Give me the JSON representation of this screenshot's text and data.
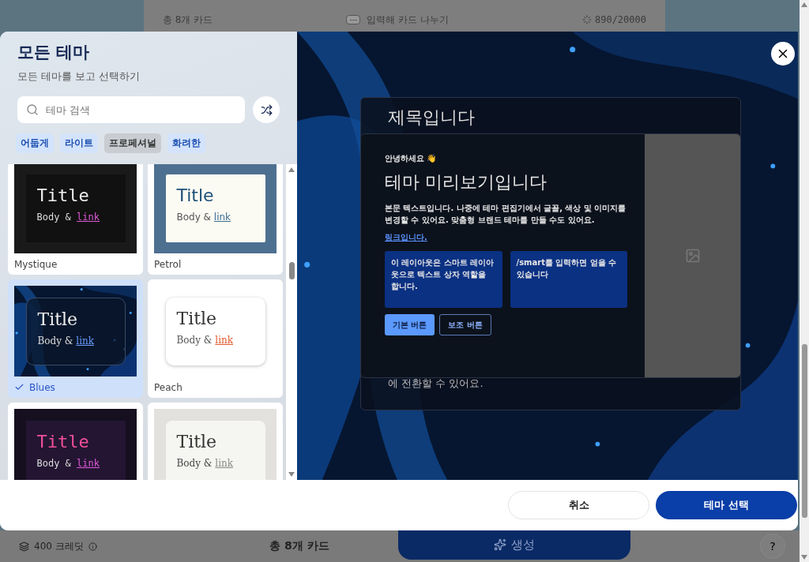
{
  "background_top": {
    "card_count": "총 8개 카드",
    "divider_hint": "입력해 카드 나누기",
    "divider_key": "---",
    "char_count": "890/20000"
  },
  "background_bottom": {
    "credits": "400 크레딧",
    "card_count": "총 8개 카드",
    "generate_button": "생성",
    "help": "?"
  },
  "theme_panel": {
    "title": "모든 테마",
    "subtitle": "모든 테마를 보고 선택하기",
    "search": {
      "placeholder": "테마 검색"
    },
    "filters": [
      {
        "label": "어둡게",
        "selected": false
      },
      {
        "label": "라이트",
        "selected": false
      },
      {
        "label": "프로페셔널",
        "selected": true
      },
      {
        "label": "화려한",
        "selected": false
      }
    ],
    "themes": [
      {
        "kind": "mystique",
        "name": "Mystique",
        "title": "Title",
        "body": "Body &",
        "link": "link",
        "selected": false
      },
      {
        "kind": "petrol",
        "name": "Petrol",
        "title": "Title",
        "body": "Body &",
        "link": "link",
        "selected": false
      },
      {
        "kind": "blues",
        "name": "Blues",
        "title": "Title",
        "body": "Body &",
        "link": "link",
        "selected": true
      },
      {
        "kind": "peach",
        "name": "Peach",
        "title": "Title",
        "body": "Body &",
        "link": "link",
        "selected": false
      },
      {
        "kind": "neon",
        "title": "Title",
        "body": "Body &",
        "link": "link",
        "selected": false
      },
      {
        "kind": "stone",
        "title": "Title",
        "body": "Body &",
        "link": "link",
        "selected": false
      }
    ]
  },
  "preview": {
    "back_card": {
      "heading": "제목입니다",
      "tail": "에 전환할 수 있어요."
    },
    "front_card": {
      "greeting": "안녕하세요 👋",
      "heading": "테마 미리보기입니다",
      "body": "본문 텍스트입니다. 나중에 테마 편집기에서 글꼴, 색상 및 이미지를 변경할 수 있어요. 맞춤형 브랜드 테마를 만들 수도 있어요.",
      "link": "링크입니다.",
      "boxes": [
        "이 레이아웃은 스마트 레이아웃으로 텍스트 상자 역할을 합니다.",
        "/smart를 입력하면 얻을 수 있습니다"
      ],
      "primary_button": "기본 버튼",
      "secondary_button": "보조 버튼"
    }
  },
  "footer": {
    "cancel": "취소",
    "confirm": "테마 선택"
  }
}
